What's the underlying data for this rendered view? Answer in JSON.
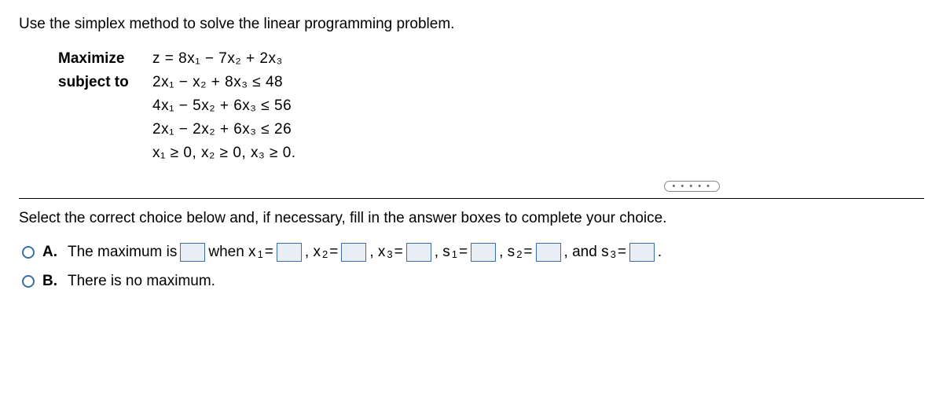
{
  "question": "Use the simplex method to solve the linear programming problem.",
  "labels": {
    "maximize": "Maximize",
    "subjectTo": "subject to"
  },
  "eq": {
    "objective": "z = 8x₁ − 7x₂ + 2x₃",
    "c1": "2x₁ −   x₂ +  8x₃ ≤ 48",
    "c2": "4x₁ − 5x₂ +  6x₃ ≤ 56",
    "c3": "2x₁ − 2x₂ +  6x₃ ≤ 26",
    "nonneg": "x₁ ≥ 0, x₂ ≥ 0, x₃ ≥ 0."
  },
  "instructions": "Select the correct choice below and, if necessary, fill in the answer boxes to complete your choice.",
  "choiceA": {
    "letter": "A.",
    "p1": "The maximum is ",
    "p2": " when x",
    "s1": "1",
    "eq": " = ",
    "comma_x": ", x",
    "s2": "2",
    "s3": "3",
    "comma_s": ", s",
    "and_s": ", and s",
    "period": "."
  },
  "choiceB": {
    "letter": "B.",
    "text": "There is no maximum."
  },
  "dots": "• • • • •"
}
